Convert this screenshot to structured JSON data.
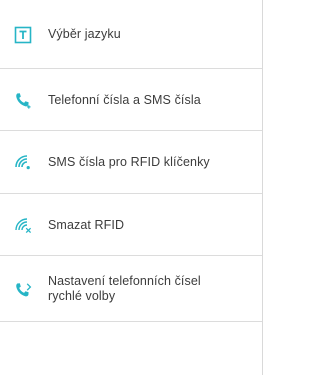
{
  "colors": {
    "accent": "#26b5c6",
    "text": "#3c3c3c",
    "divider": "#dcdcdc",
    "background": "#ffffff"
  },
  "menu": {
    "items": [
      {
        "label": "Výběr jazyku",
        "icon": "text-t-icon"
      },
      {
        "label": "Telefonní čísla a SMS čísla",
        "icon": "phone-add-icon"
      },
      {
        "label": "SMS čísla pro RFID klíčenky",
        "icon": "rfid-signal-icon"
      },
      {
        "label": "Smazat RFID",
        "icon": "rfid-delete-icon"
      },
      {
        "label": "Nastavení telefonních čísel rychlé volby",
        "icon": "phone-speed-dial-icon"
      }
    ]
  }
}
